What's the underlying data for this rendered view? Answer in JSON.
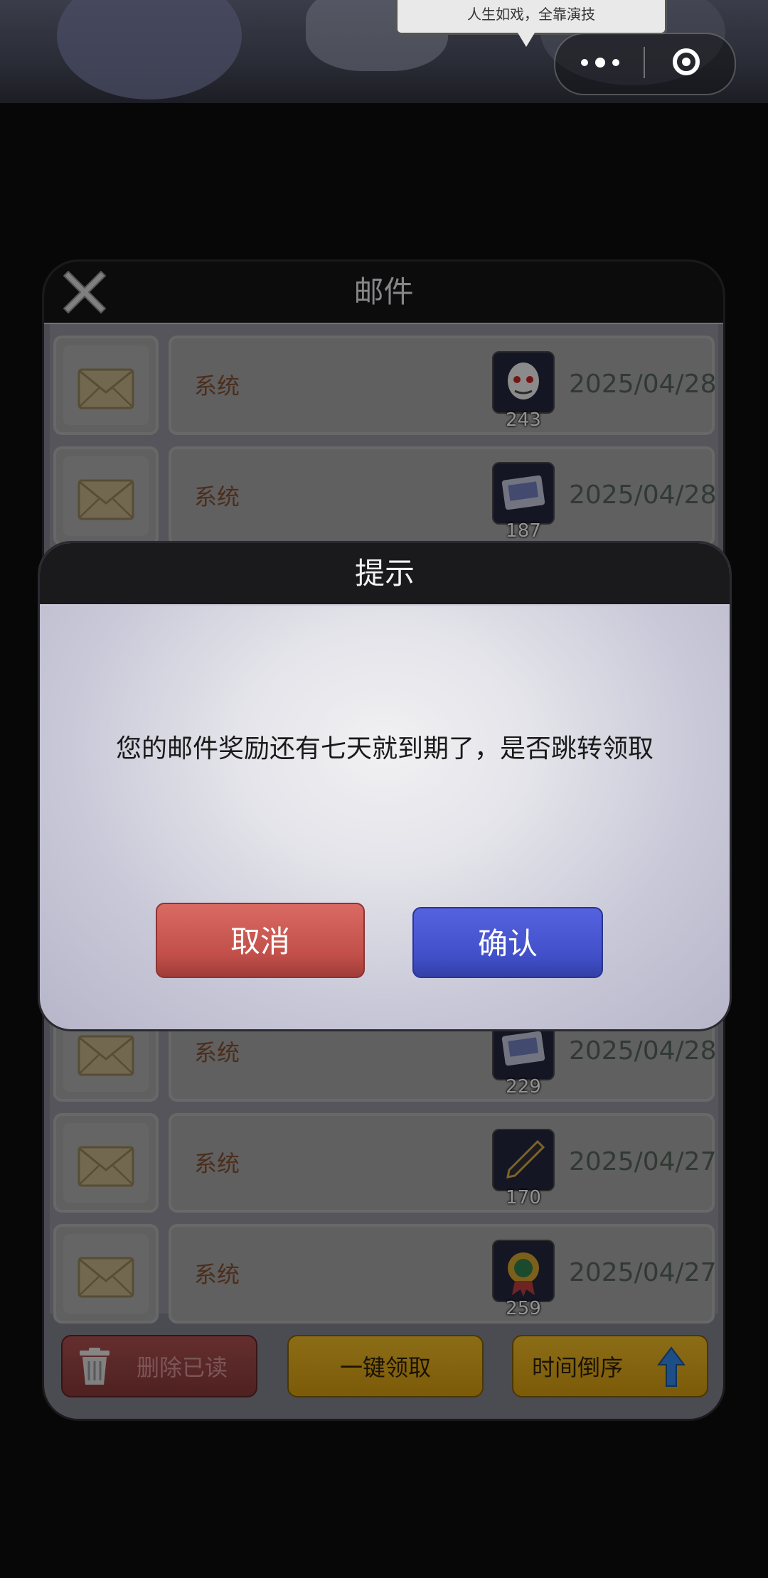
{
  "top_bar": {
    "speech_text": "人生如戏，全靠演技",
    "menu_icon": "more-dots-icon",
    "close_icon": "target-circle-icon"
  },
  "mail_panel": {
    "title": "邮件",
    "close_icon": "close-x-icon",
    "rows": [
      {
        "sender": "系统",
        "item_icon": "mask-icon",
        "count": "243",
        "date": "2025/04/28"
      },
      {
        "sender": "系统",
        "item_icon": "card-icon",
        "count": "187",
        "date": "2025/04/28"
      },
      {
        "sender": "系统",
        "item_icon": "card-icon",
        "count": "229",
        "date": "2025/04/28"
      },
      {
        "sender": "系统",
        "item_icon": "pen-icon",
        "count": "170",
        "date": "2025/04/27"
      },
      {
        "sender": "系统",
        "item_icon": "medal-icon",
        "count": "259",
        "date": "2025/04/27"
      }
    ],
    "buttons": {
      "delete_read": "删除已读",
      "claim_all": "一键领取",
      "sort": "时间倒序"
    }
  },
  "dialog": {
    "title": "提示",
    "message": "您的邮件奖励还有七天就到期了，是否跳转领取",
    "cancel": "取消",
    "confirm": "确认"
  },
  "colors": {
    "date": "#4f5d56",
    "sender": "#7a4a2e",
    "cancel": "#c24f4a",
    "confirm": "#4150c9",
    "gold": "#d8a21b"
  }
}
